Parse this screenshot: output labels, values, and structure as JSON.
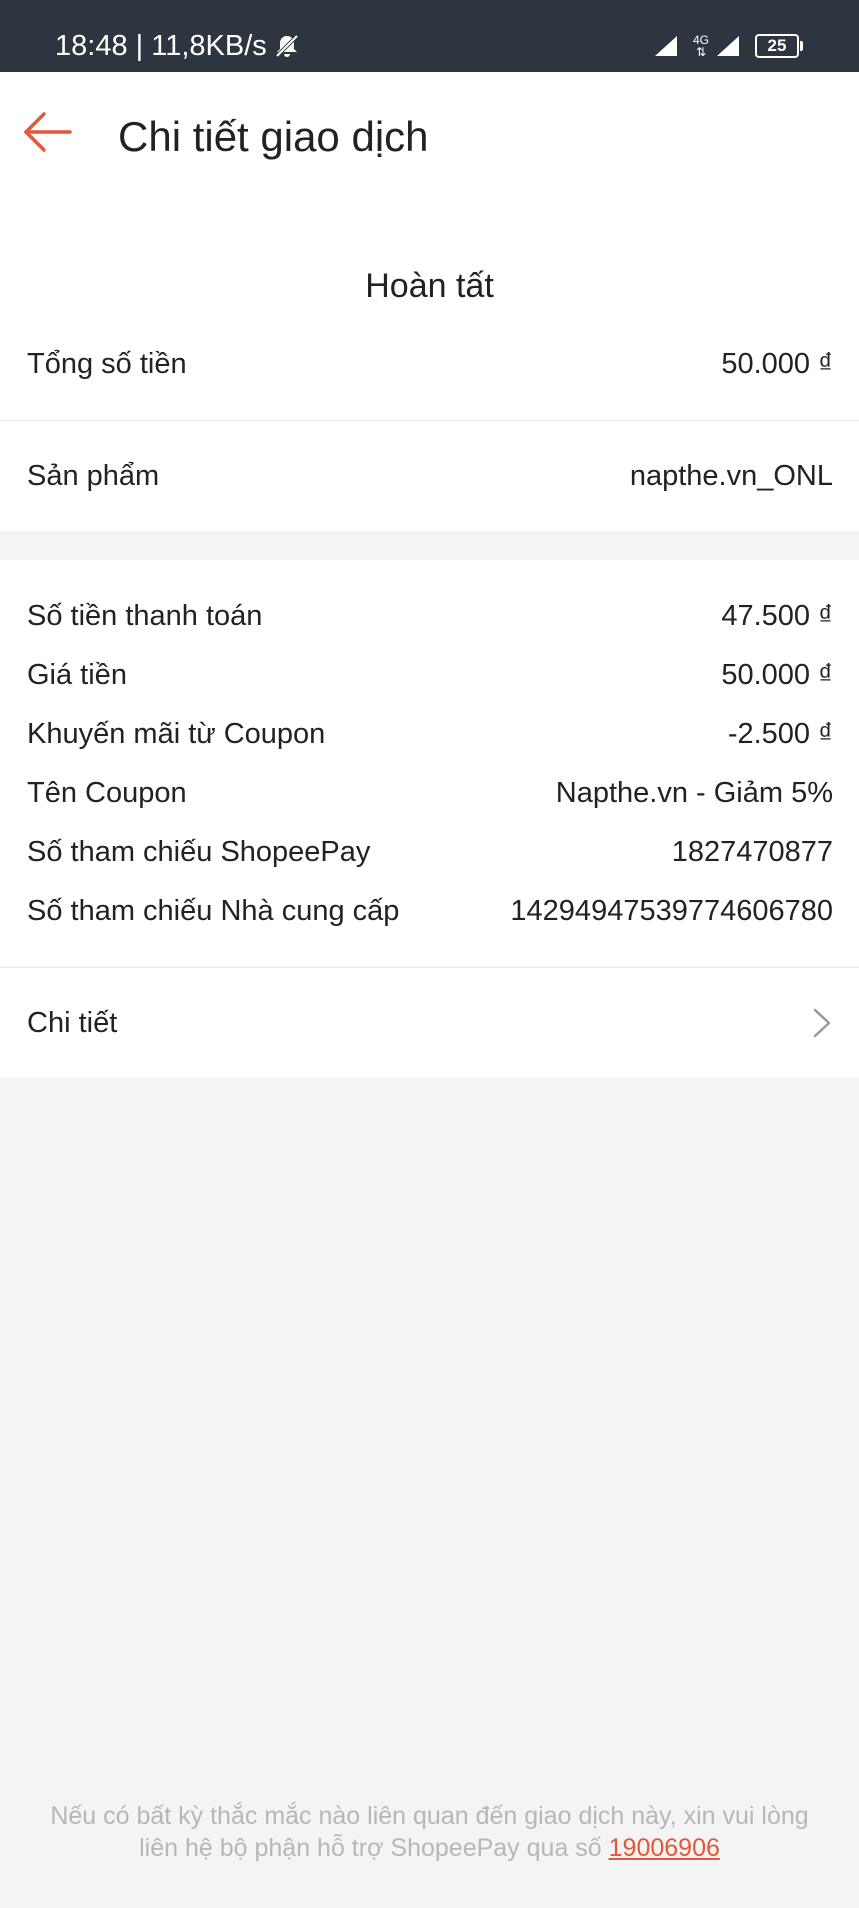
{
  "status_bar": {
    "time_speed": "18:48 | 11,8KB/s",
    "network": "4G",
    "battery": "25"
  },
  "header": {
    "title": "Chi tiết giao dịch"
  },
  "summary": {
    "status": "Hoàn tất",
    "total_label": "Tổng số tiền",
    "total_value": "50.000 ₫"
  },
  "product": {
    "label": "Sản phẩm",
    "value": "napthe.vn_ONL"
  },
  "details": [
    {
      "label": "Số tiền thanh toán",
      "value": "47.500 ₫"
    },
    {
      "label": "Giá tiền",
      "value": "50.000 ₫"
    },
    {
      "label": "Khuyến mãi từ Coupon",
      "value": "-2.500 ₫"
    },
    {
      "label": "Tên Coupon",
      "value": "Napthe.vn - Giảm 5%"
    },
    {
      "label": "Số tham chiếu ShopeePay",
      "value": "1827470877"
    },
    {
      "label": "Số tham chiếu Nhà cung cấp",
      "value": "14294947539774606780"
    }
  ],
  "more": {
    "label": "Chi tiết"
  },
  "footer": {
    "text": "Nếu có bất kỳ thắc mắc nào liên quan đến giao dịch này, xin vui lòng liên hệ bộ phận hỗ trợ ShopeePay qua số",
    "phone": "19006906"
  },
  "colors": {
    "accent": "#e4573a",
    "status_bar": "#2d3640",
    "background": "#f4f4f4"
  }
}
